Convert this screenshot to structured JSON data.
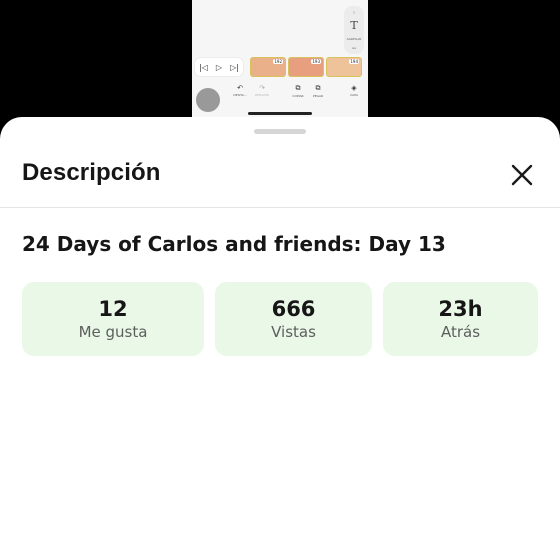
{
  "background_app": {
    "side_tool_glyph": "T",
    "side_tool_label": "AGREGAR",
    "side_tool_extra": "Aa",
    "player": {
      "skip_back": "|◁",
      "play": "▷",
      "skip_forward": "▷|"
    },
    "clips": [
      {
        "badge": "192"
      },
      {
        "badge": "193"
      },
      {
        "badge": "194"
      }
    ],
    "tools": [
      {
        "icon": "↶",
        "label": "DESHA..."
      },
      {
        "icon": "↷",
        "label": "REHACER"
      },
      {
        "icon": "⧉",
        "label": "COPIAR"
      },
      {
        "icon": "⧉",
        "label": "PEGAR"
      },
      {
        "icon": "◈",
        "label": "CAPA"
      }
    ],
    "music_icon": "♫"
  },
  "sheet": {
    "title": "Descripción",
    "close_icon": "close-icon",
    "video_title": "24 Days of Carlos and friends: Day 13",
    "stats": [
      {
        "value": "12",
        "label": "Me gusta"
      },
      {
        "value": "666",
        "label": "Vistas"
      },
      {
        "value": "23h",
        "label": "Atrás"
      }
    ],
    "stat_card_color": "#e9f8e7"
  }
}
